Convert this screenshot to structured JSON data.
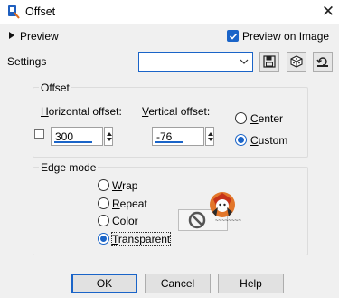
{
  "window": {
    "title": "Offset"
  },
  "preview": {
    "toggle_label": "Preview",
    "preview_on_image_label": "Preview on Image",
    "preview_on_image_checked": true
  },
  "settings": {
    "label": "Settings",
    "value": ""
  },
  "offset_group": {
    "title": "Offset",
    "horizontal": {
      "label_access_key": "H",
      "label_rest": "orizontal offset:",
      "value": "300"
    },
    "vertical": {
      "label_access_key": "V",
      "label_rest": "ertical offset:",
      "value": "-76"
    },
    "center": {
      "label_access_key": "C",
      "label_rest": "enter",
      "selected": false
    },
    "custom": {
      "label_access_key": "C",
      "label_rest": "ustom",
      "selected": true
    }
  },
  "edge_group": {
    "title": "Edge mode",
    "options": [
      {
        "key": "W",
        "rest": "rap",
        "selected": false
      },
      {
        "key": "R",
        "rest": "epeat",
        "selected": false
      },
      {
        "key": "C",
        "rest": "olor",
        "selected": false
      },
      {
        "key": "T",
        "rest": "ransparent",
        "selected": true
      }
    ]
  },
  "buttons": {
    "ok": "OK",
    "cancel": "Cancel",
    "help": "Help"
  },
  "colors": {
    "accent": "#1a64c8",
    "background": "#f0f0f0",
    "titlebar": "#ffffff"
  }
}
